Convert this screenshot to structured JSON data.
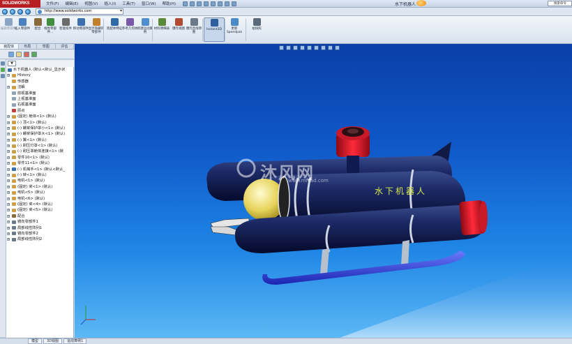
{
  "app": {
    "logo": "SOLIDWORKS",
    "doc_title": "水下机器人",
    "help_placeholder": "搜索命令"
  },
  "menu": [
    "文件(F)",
    "编辑(E)",
    "视图(V)",
    "插入(I)",
    "工具(T)",
    "窗口(W)",
    "帮助(H)"
  ],
  "address": {
    "url": "http://www.solidworks.com"
  },
  "ribbon": {
    "tools": [
      {
        "id": "edit-component",
        "label": "编辑零部件",
        "disabled": true,
        "color": "#8aa4c4"
      },
      {
        "id": "insert-component",
        "label": "插入零部件",
        "disabled": false,
        "color": "#4a7fc0"
      },
      {
        "id": "mate",
        "label": "配合",
        "disabled": false,
        "color": "#8a6a3a"
      },
      {
        "id": "linear-pattern",
        "label": "线性零部件...",
        "disabled": false,
        "color": "#3f8f3f"
      },
      {
        "id": "smart-fasteners",
        "label": "智能扣件",
        "disabled": false,
        "color": "#6b6b6b"
      },
      {
        "id": "move-component",
        "label": "移动零部件",
        "disabled": false,
        "color": "#3a6fb0"
      },
      {
        "id": "show-hidden",
        "label": "显示隐藏的零部件",
        "disabled": false,
        "color": "#c08030"
      },
      {
        "id": "assembly-features",
        "label": "装配体特征",
        "disabled": false,
        "color": "#2f6aa8"
      },
      {
        "id": "reference-geometry",
        "label": "参考几何体",
        "disabled": false,
        "color": "#7a5aa8"
      },
      {
        "id": "new-motion-study",
        "label": "新建运动算例",
        "disabled": false,
        "color": "#4f8fd0"
      },
      {
        "id": "bill-of-materials",
        "label": "材料明细表",
        "disabled": false,
        "color": "#5a8a3a"
      },
      {
        "id": "exploded-view",
        "label": "爆炸视图",
        "disabled": false,
        "color": "#b04a30"
      },
      {
        "id": "explode-line-sketch",
        "label": "爆炸直线草图",
        "disabled": false,
        "color": "#6a7a8a"
      },
      {
        "id": "instant3d",
        "label": "Instant3D",
        "disabled": false,
        "color": "#2f5f9f"
      },
      {
        "id": "speedpak",
        "label": "更新Speedpak",
        "disabled": false,
        "color": "#4a8ac8"
      },
      {
        "id": "snapshot",
        "label": "拍快照",
        "disabled": false,
        "color": "#5a6a7a"
      }
    ]
  },
  "panel": {
    "tabs": [
      "装配体",
      "布局",
      "草图",
      "评估"
    ],
    "filter_label": "▼"
  },
  "tree": {
    "items": [
      {
        "label": "水下机器人 (默认<默认_显示状",
        "expand": "",
        "indent": 0,
        "icon": "#3a6fb0"
      },
      {
        "label": "History",
        "expand": "+",
        "indent": 1,
        "icon": "#c9a14a"
      },
      {
        "label": "传感器",
        "expand": "",
        "indent": 1,
        "icon": "#c9a14a"
      },
      {
        "label": "注解",
        "expand": "+",
        "indent": 1,
        "icon": "#c9a14a"
      },
      {
        "label": "前视基准面",
        "expand": "",
        "indent": 1,
        "icon": "#8fa2b8"
      },
      {
        "label": "上视基准面",
        "expand": "",
        "indent": 1,
        "icon": "#8fa2b8"
      },
      {
        "label": "右视基准面",
        "expand": "",
        "indent": 1,
        "icon": "#8fa2b8"
      },
      {
        "label": "原点",
        "expand": "",
        "indent": 1,
        "icon": "#c04040"
      },
      {
        "label": "(固定) 舱体<1> (默认)",
        "expand": "+",
        "indent": 1,
        "icon": "#c9a14a"
      },
      {
        "label": "(-) 顶<1> (默认)",
        "expand": "+",
        "indent": 1,
        "icon": "#c9a14a"
      },
      {
        "label": "(-) 螺桨保护罩小<1> (默认)",
        "expand": "+",
        "indent": 1,
        "icon": "#c9a14a"
      },
      {
        "label": "(-) 螺桨保护罩大<1> (默认)",
        "expand": "+",
        "indent": 1,
        "icon": "#c9a14a"
      },
      {
        "label": "(-) 翼<1> (默认)",
        "expand": "+",
        "indent": 1,
        "icon": "#c9a14a"
      },
      {
        "label": "(-) 耐压灯罩<1> (默认)",
        "expand": "+",
        "indent": 1,
        "icon": "#c9a14a"
      },
      {
        "label": "(-) 耐压罩舱体连接<1> (默",
        "expand": "+",
        "indent": 1,
        "icon": "#c9a14a"
      },
      {
        "label": "零件10<1> (默认)",
        "expand": "+",
        "indent": 1,
        "icon": "#c9a14a"
      },
      {
        "label": "零件11<1> (默认)",
        "expand": "+",
        "indent": 1,
        "icon": "#c9a14a"
      },
      {
        "label": "(-) 机械手<1> (默认<默认_",
        "expand": "+",
        "indent": 1,
        "icon": "#3a6fb0"
      },
      {
        "label": "(-) 转<1> (默认)",
        "expand": "+",
        "indent": 1,
        "icon": "#c9a14a"
      },
      {
        "label": "电机<1> (默认)",
        "expand": "+",
        "indent": 1,
        "icon": "#c9a14a"
      },
      {
        "label": "(固定) 桨<1> (默认)",
        "expand": "+",
        "indent": 1,
        "icon": "#c9a14a"
      },
      {
        "label": "电机<5> (默认)",
        "expand": "+",
        "indent": 1,
        "icon": "#c9a14a"
      },
      {
        "label": "电机<6> (默认)",
        "expand": "+",
        "indent": 1,
        "icon": "#c9a14a"
      },
      {
        "label": "(固定) 桨<4> (默认)",
        "expand": "+",
        "indent": 1,
        "icon": "#c9a14a"
      },
      {
        "label": "(固定) 桨<5> (默认)",
        "expand": "+",
        "indent": 1,
        "icon": "#c9a14a"
      },
      {
        "label": "配合",
        "expand": "+",
        "indent": 1,
        "icon": "#8a6a3a"
      },
      {
        "label": "镜向零部件1",
        "expand": "+",
        "indent": 1,
        "icon": "#6a7a8a"
      },
      {
        "label": "局部线性阵列1",
        "expand": "+",
        "indent": 1,
        "icon": "#6a7a8a"
      },
      {
        "label": "镜向零部件2",
        "expand": "+",
        "indent": 1,
        "icon": "#6a7a8a"
      },
      {
        "label": "局部线性阵列2",
        "expand": "+",
        "indent": 1,
        "icon": "#6a7a8a"
      }
    ]
  },
  "viewport": {
    "hull_text": "水下机器人",
    "watermark": "沐风网",
    "watermark_sub": "www.mfcad.com"
  },
  "status": {
    "tabs": [
      "模型",
      "3D视图",
      "运动算例1"
    ]
  }
}
